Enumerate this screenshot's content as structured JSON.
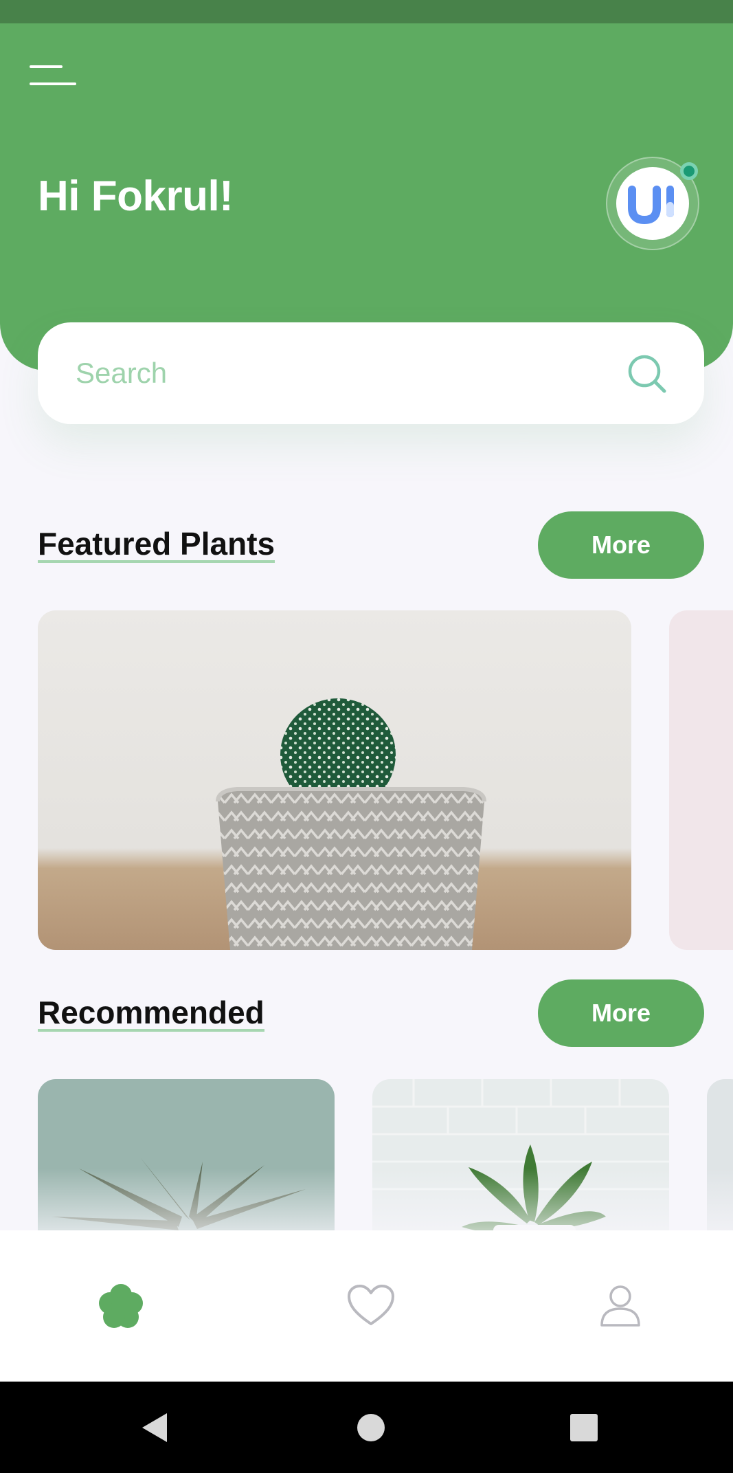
{
  "header": {
    "greeting": "Hi Fokrul!",
    "menu_icon": "hamburger-menu-icon",
    "avatar_icon": "ui-logo-avatar",
    "accent_color": "#5eab61",
    "status_bar_color": "#48824a"
  },
  "search": {
    "placeholder": "Search",
    "value": "",
    "icon": "search-icon"
  },
  "featured": {
    "title": "Featured Plants",
    "more_label": "More",
    "cards": [
      {
        "image": "cactus-in-woven-pot"
      },
      {
        "image": "pink-partial-card"
      }
    ]
  },
  "recommended": {
    "title": "Recommended",
    "more_label": "More",
    "cards": [
      {
        "image": "aloe-succulent"
      },
      {
        "image": "snake-plant-white-pot"
      },
      {
        "image": "partial-card"
      }
    ]
  },
  "bottom_nav": {
    "items": [
      {
        "icon": "flower-home-icon",
        "active": true
      },
      {
        "icon": "heart-icon",
        "active": false
      },
      {
        "icon": "user-icon",
        "active": false
      }
    ]
  },
  "system_nav": {
    "items": [
      {
        "icon": "back-triangle-icon"
      },
      {
        "icon": "home-circle-icon"
      },
      {
        "icon": "recents-square-icon"
      }
    ]
  }
}
